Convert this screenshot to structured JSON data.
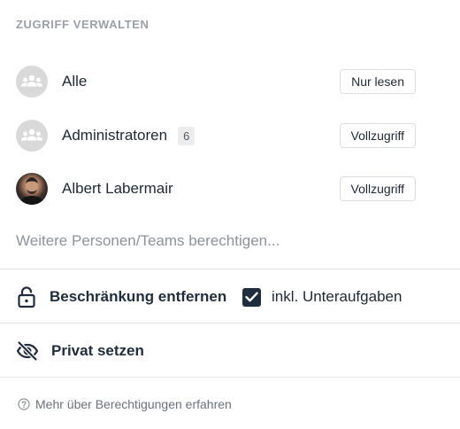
{
  "header": {
    "title": "ZUGRIFF VERWALTEN"
  },
  "members": [
    {
      "name": "Alle",
      "avatar": "group-icon",
      "badge": null,
      "access": "Nur lesen"
    },
    {
      "name": "Administratoren",
      "avatar": "group-icon",
      "badge": "6",
      "access": "Vollzugriff"
    },
    {
      "name": "Albert Labermair",
      "avatar": "user-photo",
      "badge": null,
      "access": "Vollzugriff"
    }
  ],
  "invite": {
    "placeholder": "Weitere Personen/Teams berechtigen..."
  },
  "restriction": {
    "label": "Beschränkung entfernen",
    "icon": "lock-open-icon"
  },
  "subtasks": {
    "label": "inkl. Unteraufgaben",
    "checked": true
  },
  "privacy": {
    "label": "Privat setzen",
    "icon": "eye-off-icon"
  },
  "help": {
    "label": "Mehr über Berechtigungen erfahren",
    "icon": "question-circle-icon"
  },
  "colors": {
    "accent": "#1f2d3d",
    "muted": "#9aa0a6",
    "avatar_bg": "#d9d9d9",
    "border": "#d9dde1"
  }
}
